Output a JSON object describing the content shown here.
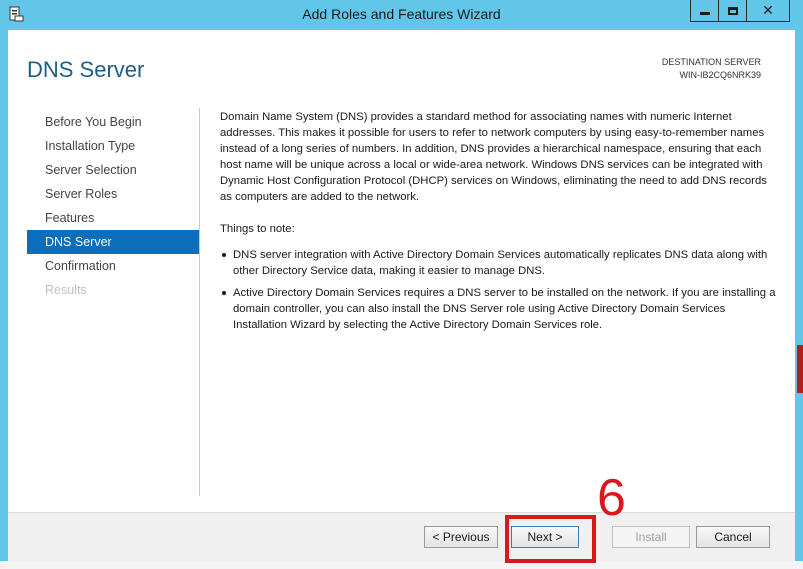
{
  "window": {
    "title": "Add Roles and Features Wizard",
    "minimize_icon": "minimize-icon",
    "maximize_icon": "maximize-icon",
    "close_icon": "close-icon",
    "close_glyph": "✕",
    "accent": "#61c6e8"
  },
  "header": {
    "page_title": "DNS Server",
    "destination_label": "DESTINATION SERVER",
    "destination_server": "WIN-IB2CQ6NRK39"
  },
  "nav": {
    "items": [
      {
        "label": "Before You Begin",
        "state": "normal"
      },
      {
        "label": "Installation Type",
        "state": "normal"
      },
      {
        "label": "Server Selection",
        "state": "normal"
      },
      {
        "label": "Server Roles",
        "state": "normal"
      },
      {
        "label": "Features",
        "state": "normal"
      },
      {
        "label": "DNS Server",
        "state": "active"
      },
      {
        "label": "Confirmation",
        "state": "normal"
      },
      {
        "label": "Results",
        "state": "disabled"
      }
    ],
    "active_color": "#0a6ebd"
  },
  "content": {
    "intro": "Domain Name System (DNS) provides a standard method for associating names with numeric Internet addresses. This makes it possible for users to refer to network computers by using easy-to-remember names instead of a long series of numbers. In addition, DNS provides a hierarchical namespace, ensuring that each host name will be unique across a local or wide-area network. Windows DNS services can be integrated with Dynamic Host Configuration Protocol (DHCP) services on Windows, eliminating the need to add DNS records as computers are added to the network.",
    "notes_heading": "Things to note:",
    "notes": [
      "DNS server integration with Active Directory Domain Services automatically replicates DNS data along with other Directory Service data, making it easier to manage DNS.",
      "Active Directory Domain Services requires a DNS server to be installed on the network. If you are installing a domain controller, you can also install the DNS Server role using Active Directory Domain Services Installation Wizard by selecting the Active Directory Domain Services role."
    ]
  },
  "footer": {
    "previous_label": "< Previous",
    "next_label": "Next >",
    "install_label": "Install",
    "cancel_label": "Cancel"
  },
  "annotation": {
    "step_number": "6",
    "color": "#d7191c"
  }
}
